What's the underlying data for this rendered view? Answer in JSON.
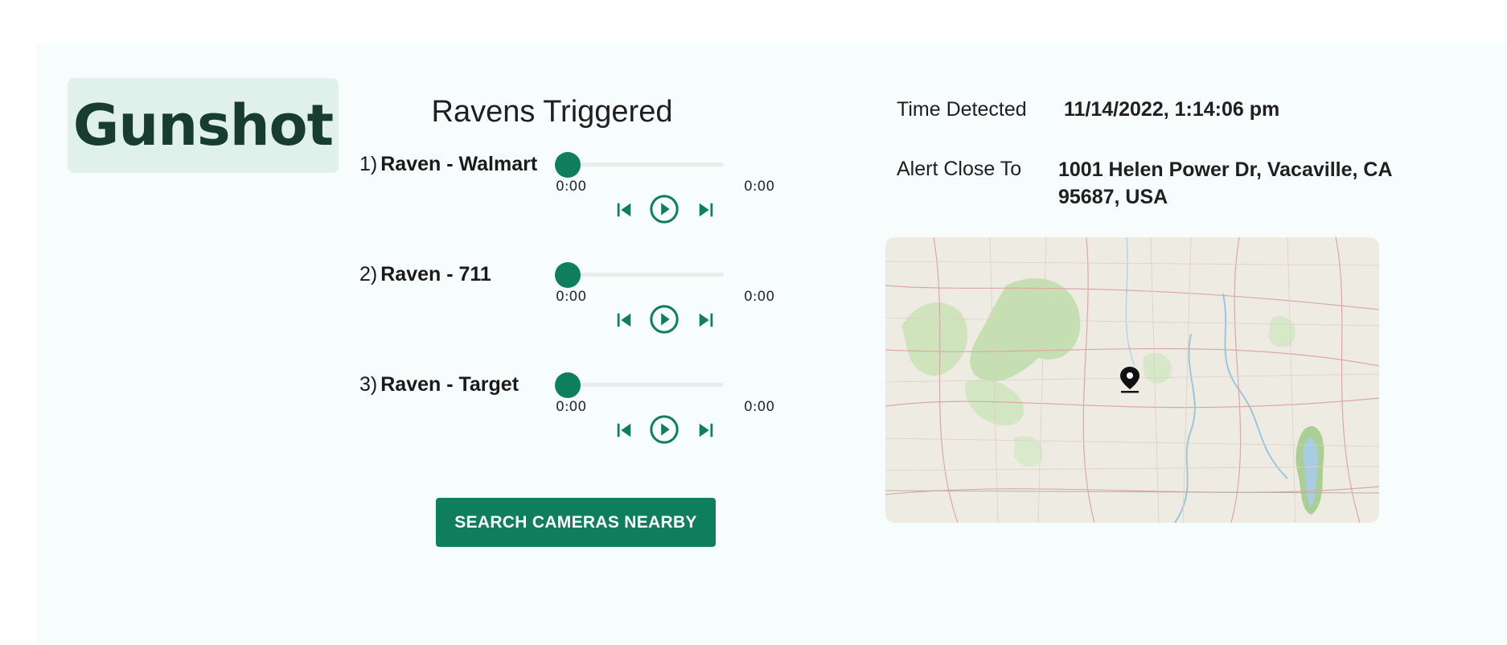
{
  "alert": {
    "type_label": "Gunshot"
  },
  "ravens": {
    "title": "Ravens Triggered",
    "items": [
      {
        "index": "1)",
        "name": "Raven - Walmart",
        "current_time": "0:00",
        "duration": "0:00",
        "progress": 0
      },
      {
        "index": "2)",
        "name": "Raven - 711",
        "current_time": "0:00",
        "duration": "0:00",
        "progress": 0
      },
      {
        "index": "3)",
        "name": "Raven - Target",
        "current_time": "0:00",
        "duration": "0:00",
        "progress": 0
      }
    ],
    "controls": {
      "prev_icon": "skip-previous-icon",
      "play_icon": "play-circle-icon",
      "next_icon": "skip-next-icon"
    }
  },
  "actions": {
    "search_cameras_label": "SEARCH CAMERAS NEARBY"
  },
  "details": {
    "time_label": "Time Detected",
    "time_value": "11/14/2022, 1:14:06 pm",
    "location_label": "Alert Close To",
    "location_value": "1001 Helen Power Dr, Vacaville, CA 95687, USA"
  },
  "map": {
    "marker_icon": "map-pin-icon"
  },
  "colors": {
    "accent": "#0f7f5b",
    "badge_bg": "#e0f1ec",
    "badge_text": "#173d31",
    "panel_bg": "#f6fdfc"
  }
}
